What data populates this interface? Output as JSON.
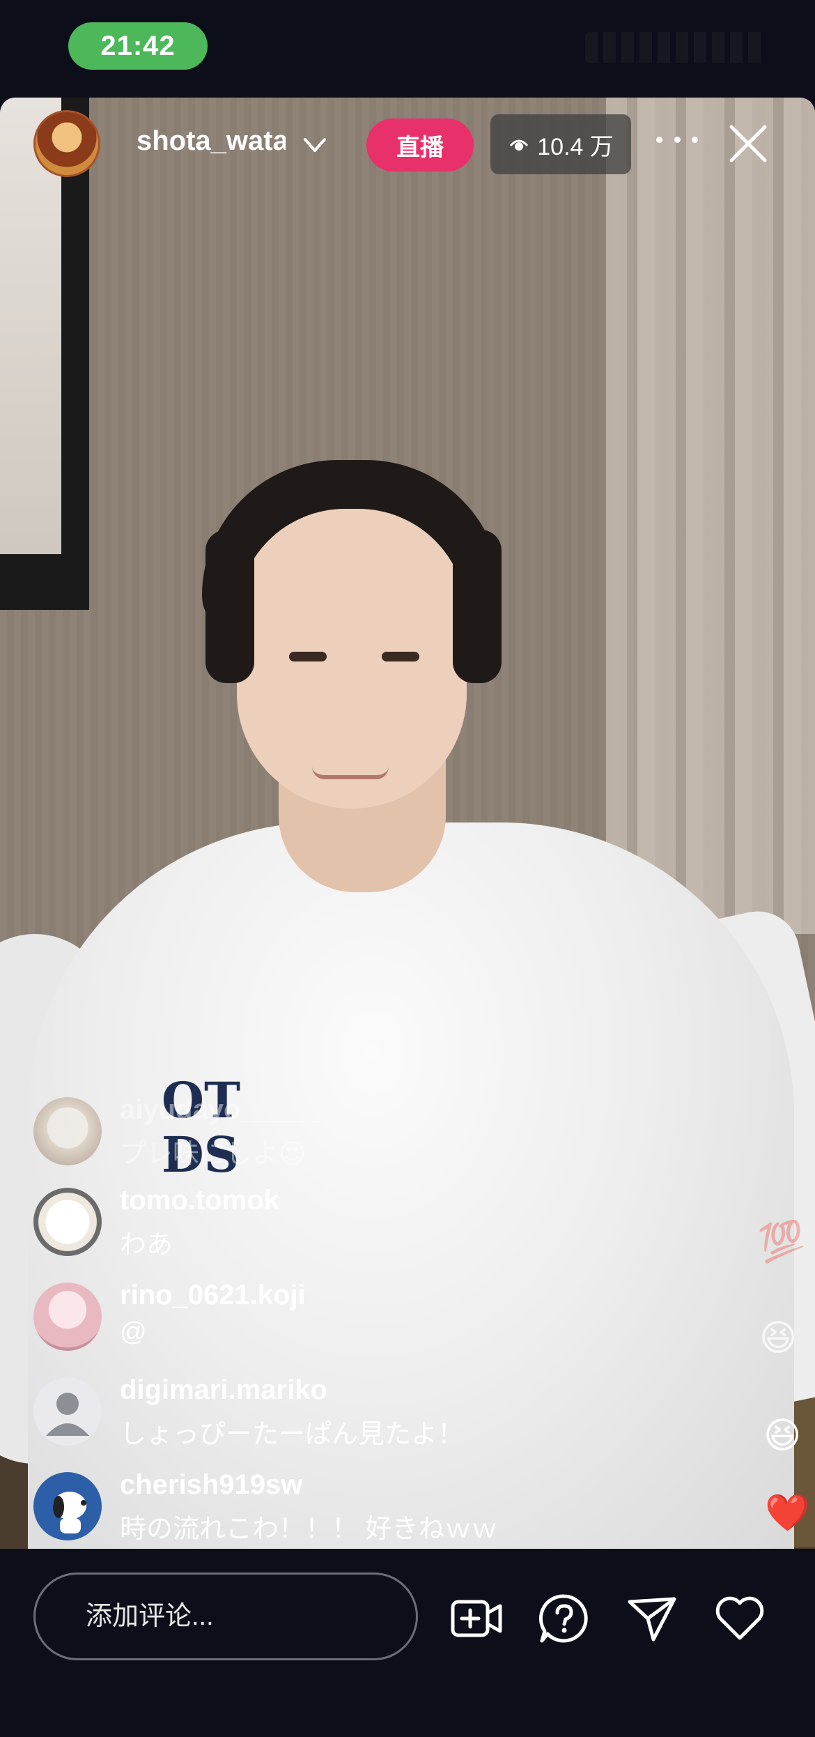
{
  "status_bar": {
    "time": "21:42"
  },
  "host": {
    "username": "shota_wata",
    "live_label": "直播",
    "viewers": "10.4 万"
  },
  "comments": [
    {
      "user": "aiyudayo_____",
      "text": "プレ味にしよ😍",
      "faded": true
    },
    {
      "user": "tomo.tomok",
      "text": "わあ"
    },
    {
      "user": "rino_0621.koji",
      "text": "@"
    },
    {
      "user": "digimari.mariko",
      "text": "しょっぴーたーぱん見たよ！"
    },
    {
      "user": "cherish919sw",
      "text": "時の流れこわ！！！ 好きねｗｗ"
    }
  ],
  "reactions": [
    "💯",
    "😆",
    "😆",
    "❤️"
  ],
  "bottom_bar": {
    "comment_placeholder": "添加评论..."
  },
  "icons": {
    "add_video": "video-plus-icon",
    "question": "question-icon",
    "share": "paper-plane-icon",
    "like": "heart-icon"
  },
  "colors": {
    "live": "#e8306a",
    "clock": "#4cb85a",
    "background": "#0c0f1a"
  }
}
